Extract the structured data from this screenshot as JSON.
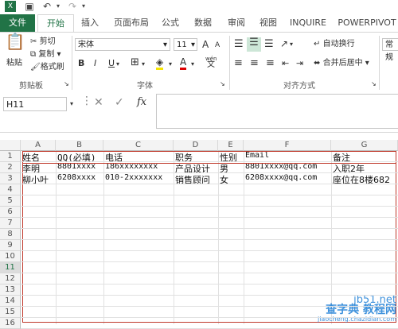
{
  "quick_access": {
    "save_icon": "save-icon",
    "undo_icon": "undo-icon",
    "redo_icon": "redo-icon"
  },
  "tabs": [
    "文件",
    "开始",
    "插入",
    "页面布局",
    "公式",
    "数据",
    "审阅",
    "视图",
    "INQUIRE",
    "POWERPIVOT"
  ],
  "ribbon": {
    "clipboard": {
      "paste": "粘贴",
      "cut": "剪切",
      "copy": "复制",
      "format_painter": "格式刷",
      "group": "剪贴板"
    },
    "font": {
      "name": "宋体",
      "size": "11",
      "bold": "B",
      "italic": "I",
      "underline": "U",
      "grow": "A",
      "shrink": "A",
      "group": "字体",
      "wen": "wén"
    },
    "alignment": {
      "wrap": "自动换行",
      "merge": "合并后居中",
      "group": "对齐方式"
    },
    "number": {
      "format": "常规"
    }
  },
  "formula_bar": {
    "name_box": "H11",
    "fx": "fx",
    "cancel": "✕",
    "enter": "✓",
    "formula": ""
  },
  "columns": [
    "A",
    "B",
    "C",
    "D",
    "E",
    "F",
    "G"
  ],
  "rows": [
    "1",
    "2",
    "3",
    "4",
    "5",
    "6",
    "7",
    "8",
    "9",
    "10",
    "11",
    "12",
    "13",
    "14",
    "15",
    "16"
  ],
  "cells": [
    [
      "姓名",
      "QQ(必填)",
      "电话",
      "职务",
      "性别",
      "Email",
      "备注"
    ],
    [
      "李明",
      "8801xxxx",
      "186xxxxxxxx",
      "产品设计",
      "男",
      "8801xxxx@qq.com",
      "入职2年"
    ],
    [
      "柳小叶",
      "6208xxxx",
      "010-2xxxxxxx",
      "销售顾问",
      "女",
      "6208xxxx@qq.com",
      "座位在8楼682"
    ]
  ],
  "watermark": {
    "line1": "查字典 教程网",
    "line2": "jiaocheng.chazidian.com",
    "site": "jb51.net"
  }
}
